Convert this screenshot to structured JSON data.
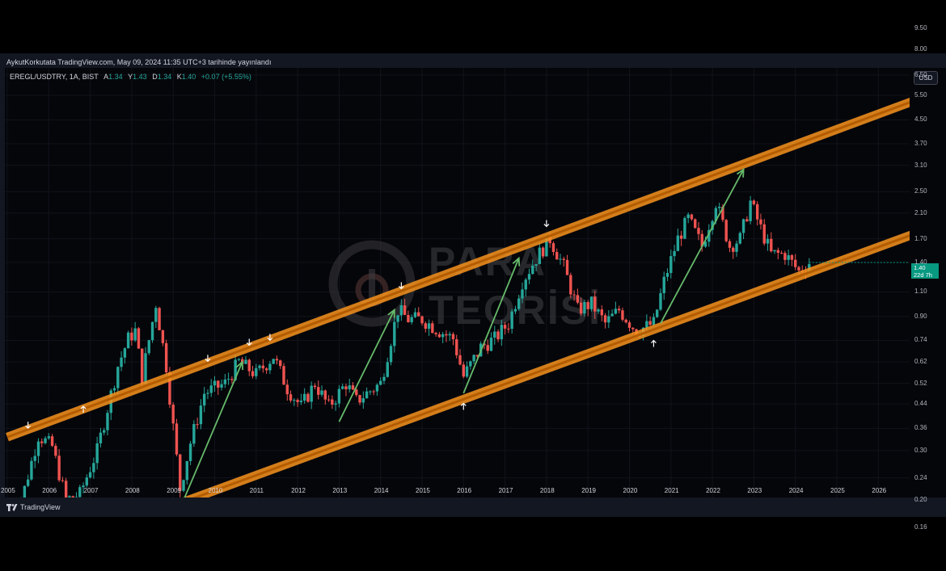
{
  "header": {
    "publisher_line": "AykutKorkutata TradingView.com, May 09, 2024 11:35 UTC+3 tarihinde yayınlandı"
  },
  "legend": {
    "symbol": "EREGL/USDTRY, 1A, BIST",
    "open_label": "A",
    "open": "1.34",
    "high_label": "Y",
    "high": "1.43",
    "low_label": "D",
    "low": "1.34",
    "close_label": "K",
    "close": "1.40",
    "change": "+0.07 (+5.55%)"
  },
  "price_axis": {
    "currency": "USD",
    "last_price": "1.40",
    "countdown": "22d 7h"
  },
  "watermark": {
    "line1": "PARA",
    "line2": "TEORİSİ"
  },
  "footer": {
    "brand": "TradingView"
  },
  "colors": {
    "up": "#26a69a",
    "down": "#ef5350",
    "channel": "#f7931e",
    "arrow": "#66bb6a",
    "background": "#131722",
    "pane": "#05060a"
  },
  "chart_data": {
    "type": "candlestick",
    "timeframe": "1A",
    "y_scale": "log",
    "ylim": [
      0.14,
      10.5
    ],
    "xlim": [
      "2005-01",
      "2026-12"
    ],
    "price_ticks": [
      "9.50",
      "8.00",
      "6.50",
      "5.50",
      "4.50",
      "3.70",
      "3.10",
      "2.50",
      "2.10",
      "1.70",
      "1.40",
      "1.10",
      "0.90",
      "0.74",
      "0.62",
      "0.52",
      "0.44",
      "0.36",
      "0.30",
      "0.24",
      "0.20",
      "0.16"
    ],
    "year_ticks": [
      "2005",
      "2006",
      "2007",
      "2008",
      "2009",
      "2010",
      "2011",
      "2012",
      "2013",
      "2014",
      "2015",
      "2016",
      "2017",
      "2018",
      "2019",
      "2020",
      "2021",
      "2022",
      "2023",
      "2024",
      "2025",
      "2026"
    ],
    "anchors": [
      [
        "2005-01",
        0.15
      ],
      [
        "2005-06",
        0.22
      ],
      [
        "2005-10",
        0.34
      ],
      [
        "2006-02",
        0.31
      ],
      [
        "2006-06",
        0.2
      ],
      [
        "2006-10",
        0.21
      ],
      [
        "2007-03",
        0.3
      ],
      [
        "2007-09",
        0.6
      ],
      [
        "2007-12",
        0.75
      ],
      [
        "2008-02",
        0.8
      ],
      [
        "2008-04",
        0.55
      ],
      [
        "2008-08",
        1.0
      ],
      [
        "2008-11",
        0.6
      ],
      [
        "2009-03",
        0.22
      ],
      [
        "2009-06",
        0.32
      ],
      [
        "2009-10",
        0.48
      ],
      [
        "2010-04",
        0.52
      ],
      [
        "2010-08",
        0.62
      ],
      [
        "2011-01",
        0.56
      ],
      [
        "2011-06",
        0.65
      ],
      [
        "2011-10",
        0.5
      ],
      [
        "2012-02",
        0.43
      ],
      [
        "2012-06",
        0.52
      ],
      [
        "2012-10",
        0.43
      ],
      [
        "2013-03",
        0.52
      ],
      [
        "2013-06",
        0.45
      ],
      [
        "2013-09",
        0.48
      ],
      [
        "2014-01",
        0.52
      ],
      [
        "2014-06",
        0.95
      ],
      [
        "2014-09",
        0.88
      ],
      [
        "2015-01",
        0.88
      ],
      [
        "2015-06",
        0.8
      ],
      [
        "2015-10",
        0.75
      ],
      [
        "2016-01",
        0.55
      ],
      [
        "2016-06",
        0.7
      ],
      [
        "2016-10",
        0.75
      ],
      [
        "2017-02",
        0.85
      ],
      [
        "2017-06",
        1.2
      ],
      [
        "2017-10",
        1.45
      ],
      [
        "2018-02",
        1.7
      ],
      [
        "2018-06",
        1.35
      ],
      [
        "2018-10",
        0.95
      ],
      [
        "2019-02",
        1.0
      ],
      [
        "2019-06",
        0.85
      ],
      [
        "2019-10",
        0.95
      ],
      [
        "2020-03",
        0.8
      ],
      [
        "2020-08",
        0.85
      ],
      [
        "2020-11",
        1.2
      ],
      [
        "2021-03",
        1.7
      ],
      [
        "2021-06",
        2.0
      ],
      [
        "2021-10",
        1.6
      ],
      [
        "2022-02",
        2.3
      ],
      [
        "2022-06",
        1.6
      ],
      [
        "2022-09",
        1.7
      ],
      [
        "2022-12",
        2.3
      ],
      [
        "2023-03",
        1.85
      ],
      [
        "2023-06",
        1.5
      ],
      [
        "2023-10",
        1.5
      ],
      [
        "2024-02",
        1.3
      ],
      [
        "2024-05",
        1.4
      ]
    ],
    "channel_upper": [
      [
        "2005-01",
        0.335
      ],
      [
        "2026-12",
        5.3
      ]
    ],
    "channel_lower": [
      [
        "2009-03",
        0.195
      ],
      [
        "2026-12",
        1.78
      ]
    ],
    "trend_arrows": [
      [
        [
          "2009-04",
          0.2
        ],
        [
          "2010-09",
          0.62
        ]
      ],
      [
        [
          "2013-01",
          0.38
        ],
        [
          "2014-05",
          0.95
        ]
      ],
      [
        [
          "2016-01",
          0.48
        ],
        [
          "2017-05",
          1.45
        ]
      ],
      [
        [
          "2020-10",
          0.85
        ],
        [
          "2022-10",
          3.0
        ]
      ]
    ],
    "top_markers": [
      [
        "2005-07",
        0.37
      ],
      [
        "2009-11",
        0.64
      ],
      [
        "2010-11",
        0.73
      ],
      [
        "2011-05",
        0.76
      ],
      [
        "2014-07",
        1.16
      ],
      [
        "2018-01",
        1.93
      ]
    ],
    "bottom_markers": [
      [
        "2006-11",
        0.42
      ],
      [
        "2009-03",
        0.17
      ],
      [
        "2016-01",
        0.43
      ],
      [
        "2020-08",
        0.72
      ]
    ]
  }
}
